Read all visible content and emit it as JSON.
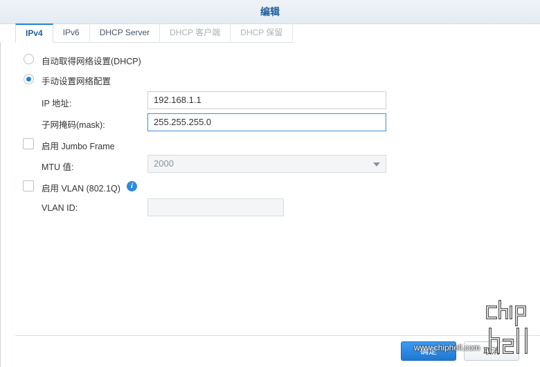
{
  "window": {
    "title": "编辑"
  },
  "tabs": [
    {
      "label": "IPv4",
      "state": "active"
    },
    {
      "label": "IPv6",
      "state": "normal"
    },
    {
      "label": "DHCP Server",
      "state": "normal"
    },
    {
      "label": "DHCP 客户端",
      "state": "disabled"
    },
    {
      "label": "DHCP 保留",
      "state": "disabled"
    }
  ],
  "form": {
    "auto_dhcp": {
      "label": "自动取得网络设置(DHCP)",
      "checked": false
    },
    "manual": {
      "label": "手动设置网络配置",
      "checked": true
    },
    "ip": {
      "label": "IP 地址:",
      "value": "192.168.1.1"
    },
    "mask": {
      "label": "子网掩码(mask):",
      "value": "255.255.255.0"
    },
    "jumbo": {
      "label": "启用 Jumbo Frame",
      "checked": false
    },
    "mtu": {
      "label": "MTU 值:",
      "value": "2000"
    },
    "vlan": {
      "label": "启用 VLAN (802.1Q)",
      "checked": false
    },
    "vlan_id": {
      "label": "VLAN ID:",
      "value": ""
    }
  },
  "footer": {
    "ok_label": "确定",
    "cancel_label": "取消"
  },
  "watermark": {
    "url": "www.chiphell.com",
    "logo": "chip hell"
  },
  "colors": {
    "accent": "#1f80d9",
    "title": "#1f5e9c"
  }
}
